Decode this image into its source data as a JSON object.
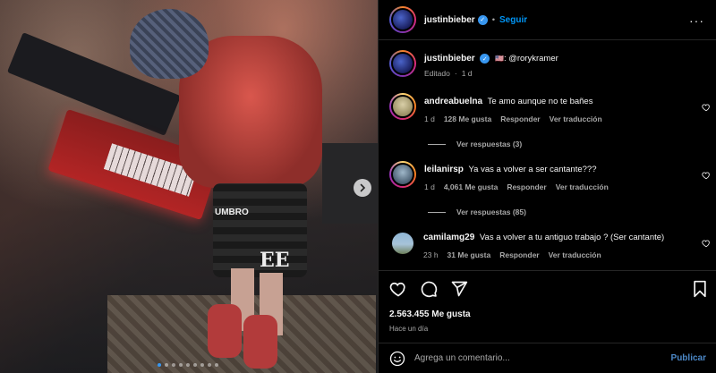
{
  "post": {
    "author": "justinbieber",
    "follow_label": "Seguir",
    "more_icon": "more-icon",
    "caption_flag": "🇺🇸",
    "caption_text": ": @rorykramer",
    "edited_label": "Editado",
    "edited_time": "1 d",
    "media_dots_count": "9",
    "media_active_dot": "1"
  },
  "comments": [
    {
      "user": "andreabuelna",
      "text": "Te amo aunque no te bañes",
      "time": "1 d",
      "likes": "128 Me gusta",
      "reply": "Responder",
      "translate": "Ver traducción",
      "replies": "Ver respuestas (3)"
    },
    {
      "user": "leilanirsp",
      "text": "Ya vas a volver a ser cantante???",
      "time": "1 d",
      "likes": "4,061 Me gusta",
      "reply": "Responder",
      "translate": "Ver traducción",
      "replies": "Ver respuestas (85)"
    },
    {
      "user": "camilamg29",
      "text": "Vas a volver a tu antiguo trabajo ? (Ser cantante)",
      "time": "23 h",
      "likes": "31 Me gusta",
      "reply": "Responder",
      "translate": "Ver traducción"
    }
  ],
  "actions": {
    "likes_count": "2.563.455 Me gusta",
    "time_ago": "Hace un día"
  },
  "compose": {
    "placeholder": "Agrega un comentario...",
    "publish_label": "Publicar"
  },
  "photo_text": {
    "shorts_brand": "UMBRO",
    "shorts_logo": "EE"
  },
  "colors": {
    "accent": "#0095f6",
    "background": "#000000",
    "muted_text": "#a8a8a8",
    "verified": "#3897f0"
  }
}
